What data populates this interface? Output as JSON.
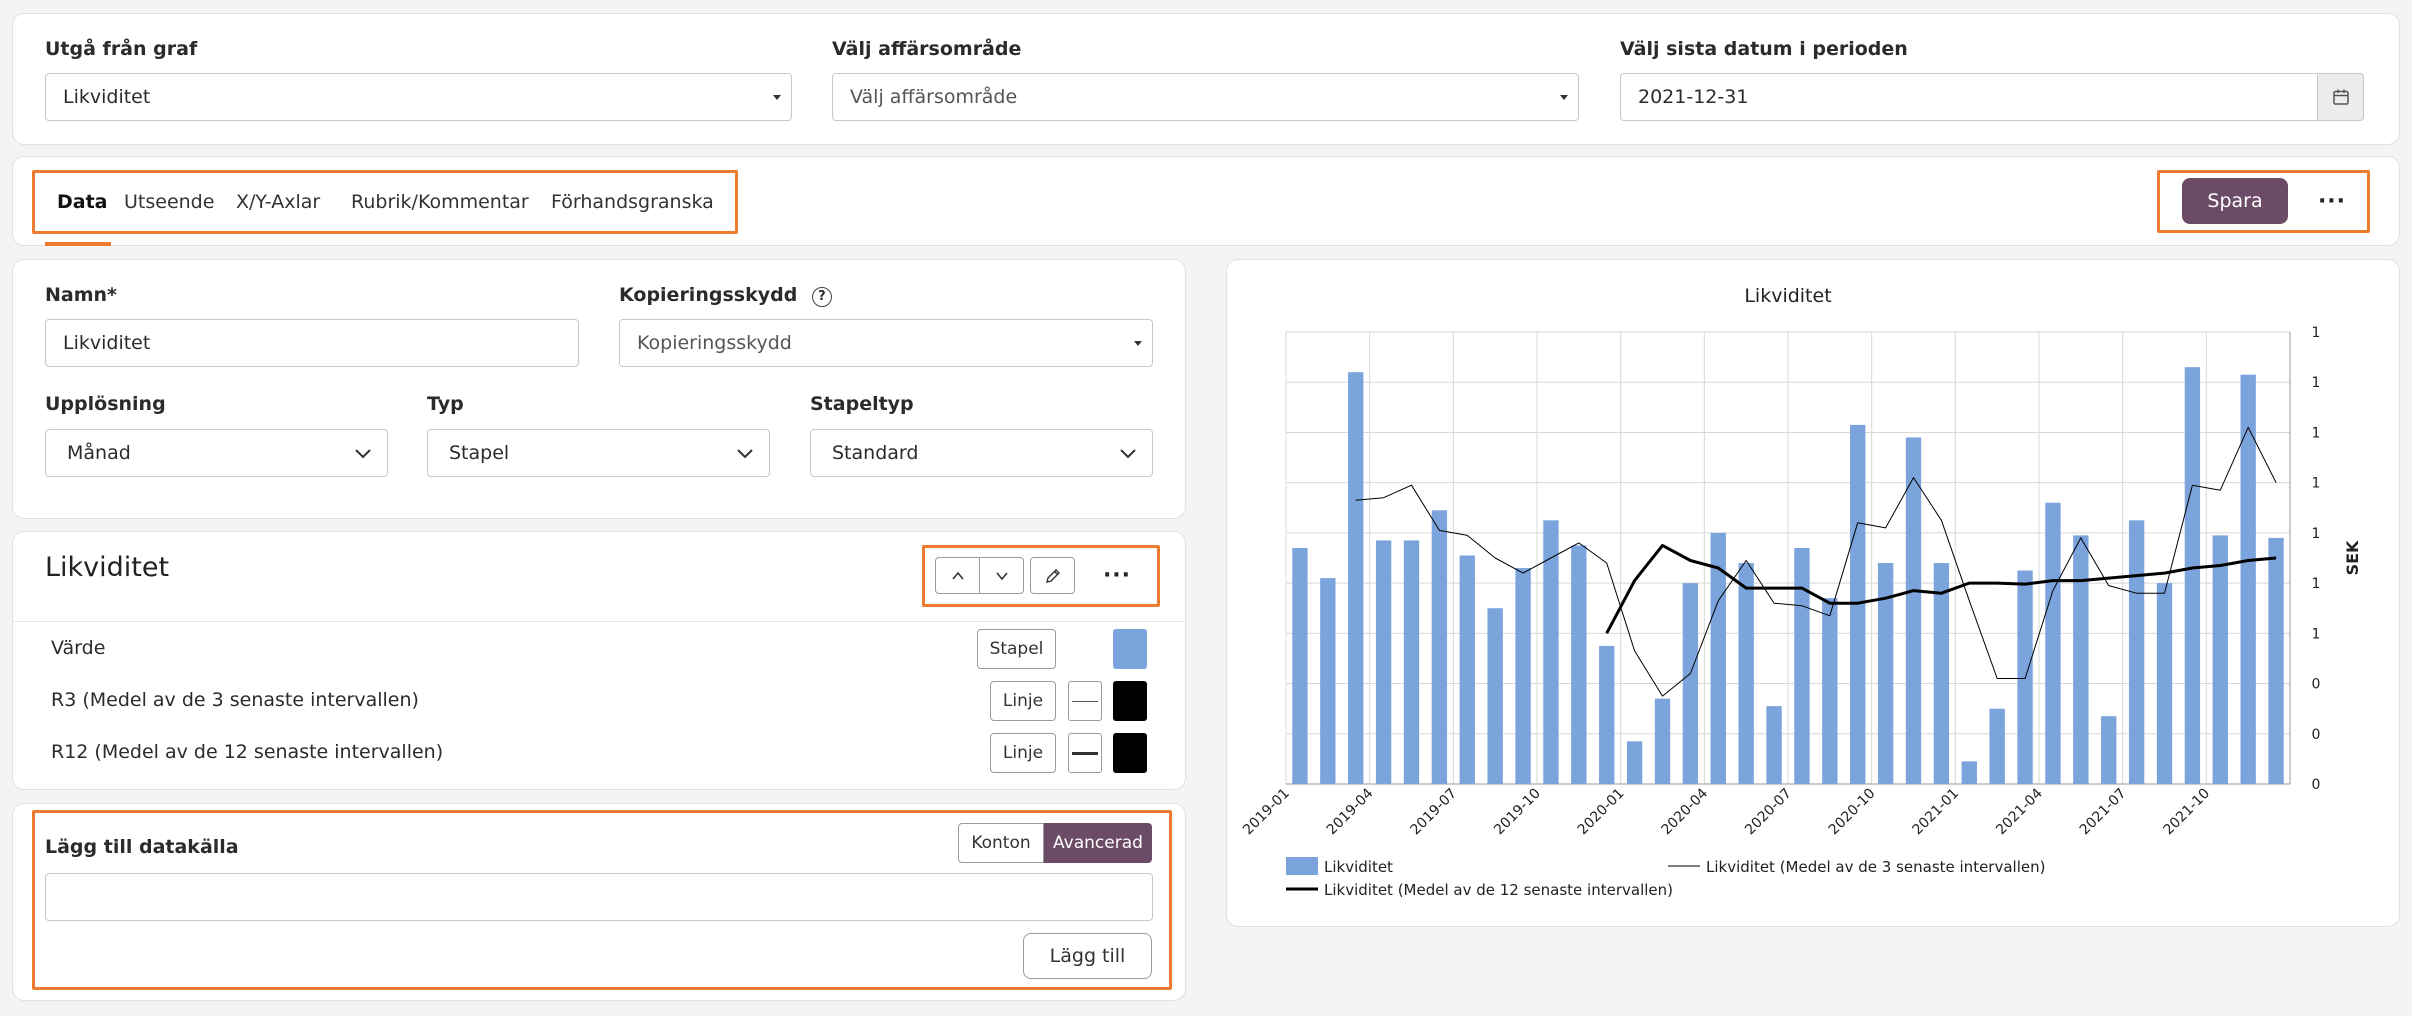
{
  "filters": {
    "graph_label": "Utgå från graf",
    "graph_value": "Likviditet",
    "area_label": "Välj affärsområde",
    "area_value": "Välj affärsområde",
    "date_label": "Välj sista datum i perioden",
    "date_value": "2021-12-31"
  },
  "tabs": [
    "Data",
    "Utseende",
    "X/Y-Axlar",
    "Rubrik/Kommentar",
    "Förhandsgranska"
  ],
  "toolbar": {
    "save_label": "Spara",
    "more_label": "···"
  },
  "form": {
    "name_label": "Namn*",
    "name_value": "Likviditet",
    "copy_label": "Kopieringsskydd",
    "copy_value": "Kopieringsskydd",
    "resolution_label": "Upplösning",
    "resolution_value": "Månad",
    "type_label": "Typ",
    "type_value": "Stapel",
    "bartype_label": "Stapeltyp",
    "bartype_value": "Standard"
  },
  "series_panel": {
    "title": "Likviditet",
    "more_label": "···",
    "rows": [
      {
        "label": "Värde",
        "type": "Stapel",
        "color": "#7ba3dc"
      },
      {
        "label": "R3 (Medel av de 3 senaste intervallen)",
        "type": "Linje",
        "color": "#000000"
      },
      {
        "label": "R12 (Medel av de 12 senaste intervallen)",
        "type": "Linje",
        "color": "#000000"
      }
    ]
  },
  "datasource": {
    "title": "Lägg till datakälla",
    "mode_accounts": "Konton",
    "mode_advanced": "Avancerad",
    "input_value": "",
    "add_label": "Lägg till"
  },
  "colors": {
    "accent": "#ef7b2f",
    "primary": "#6b4b66",
    "bar": "#7ba3dc"
  },
  "chart_data": {
    "type": "bar",
    "title": "Likviditet",
    "ylabel": "SEK",
    "y_tick_labels": [
      "0",
      "0",
      "0",
      "1",
      "1",
      "1",
      "1",
      "1",
      "1",
      "1"
    ],
    "x_tick_labels": [
      "2019-01",
      "2019-04",
      "2019-07",
      "2019-10",
      "2020-01",
      "2020-04",
      "2020-07",
      "2020-10",
      "2021-01",
      "2021-04",
      "2021-07",
      "2021-10"
    ],
    "ylim": [
      0,
      9
    ],
    "grid": true,
    "legend_position": "bottom",
    "series": [
      {
        "name": "Likviditet",
        "kind": "bar",
        "values": [
          4.7,
          4.1,
          8.2,
          4.85,
          4.85,
          5.45,
          4.55,
          3.5,
          4.3,
          5.25,
          4.75,
          2.75,
          0.85,
          1.7,
          4.0,
          5.0,
          4.4,
          1.55,
          4.7,
          3.7,
          7.15,
          4.4,
          6.9,
          4.4,
          0.45,
          1.5,
          4.25,
          5.6,
          4.95,
          1.35,
          5.25,
          4.0,
          8.3,
          4.95,
          8.15,
          4.9
        ]
      },
      {
        "name": "Likviditet (Medel av de 3 senaste intervallen)",
        "kind": "line",
        "width": 1,
        "values": [
          null,
          null,
          5.65,
          5.7,
          5.95,
          5.05,
          4.95,
          4.5,
          4.2,
          4.5,
          4.8,
          4.4,
          2.65,
          1.75,
          2.2,
          3.65,
          4.45,
          3.6,
          3.55,
          3.35,
          5.2,
          5.1,
          6.1,
          5.25,
          3.65,
          2.1,
          2.1,
          3.85,
          4.9,
          3.95,
          3.8,
          3.8,
          5.95,
          5.85,
          7.1,
          6.0
        ]
      },
      {
        "name": "Likviditet (Medel av de 12 senaste intervallen)",
        "kind": "line",
        "width": 3,
        "values": [
          null,
          null,
          null,
          null,
          null,
          null,
          null,
          null,
          null,
          null,
          null,
          3.0,
          4.05,
          4.75,
          4.45,
          4.3,
          3.9,
          3.9,
          3.9,
          3.6,
          3.6,
          3.7,
          3.85,
          3.8,
          4.0,
          4.0,
          3.98,
          4.05,
          4.05,
          4.1,
          4.15,
          4.2,
          4.3,
          4.35,
          4.45,
          4.5
        ]
      }
    ]
  }
}
